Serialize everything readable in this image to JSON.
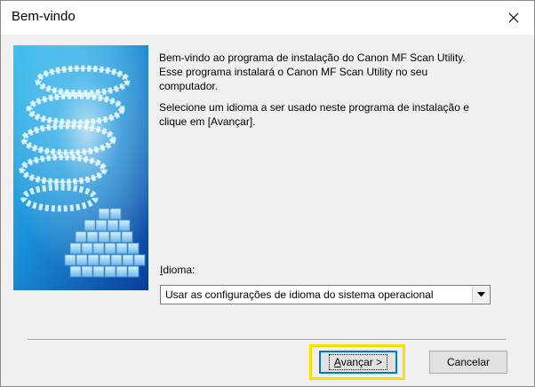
{
  "window": {
    "title": "Bem-vindo"
  },
  "main": {
    "paragraphs": [
      "Bem-vindo ao programa de instalação do Canon MF Scan Utility.\nEsse programa instalará o Canon MF Scan Utility no seu\ncomputador.",
      "Selecione um idioma a ser usado neste programa de instalação e\nclique em [Avançar]."
    ],
    "language_label_mnemonic": "I",
    "language_label_rest": "dioma:",
    "language_selected": "Usar as configurações de idioma do sistema operacional"
  },
  "buttons": {
    "next_mnemonic": "A",
    "next_rest": "vançar >",
    "cancel": "Cancelar"
  },
  "colors": {
    "focus_highlight": "#f2e400",
    "focus_border": "#0078d7"
  },
  "icons": {
    "close": "close-icon",
    "dropdown": "chevron-down-icon"
  }
}
